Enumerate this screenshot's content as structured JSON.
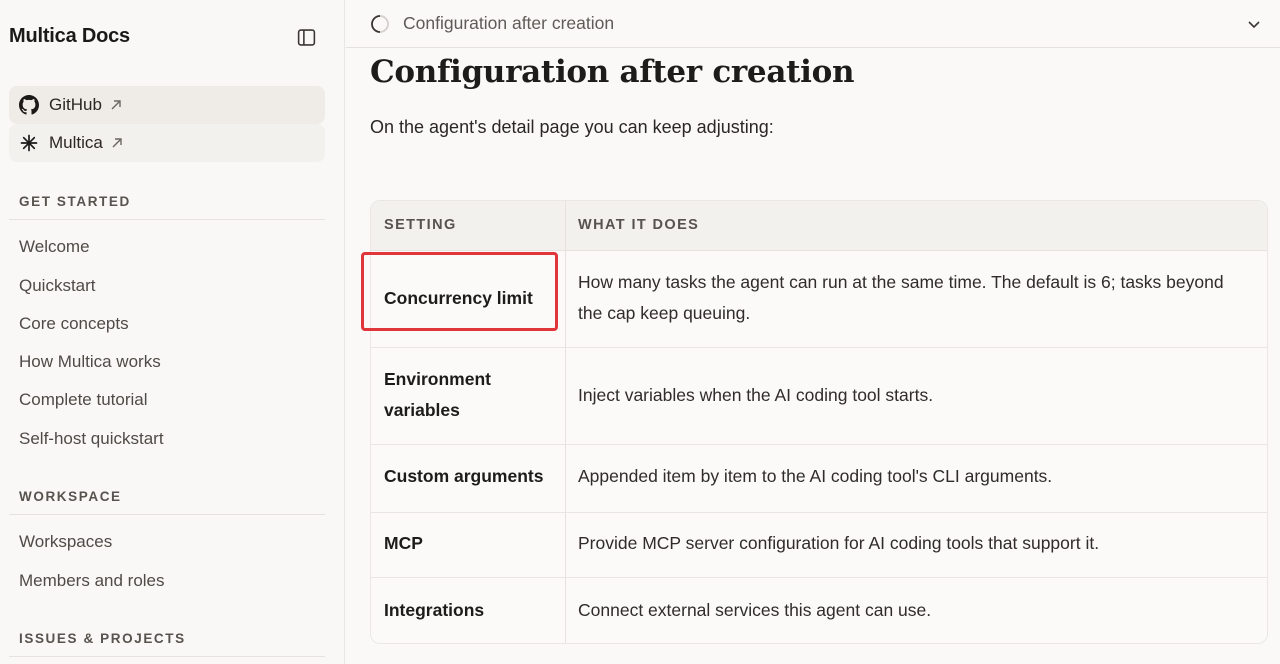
{
  "sidebar": {
    "brand": "Multica Docs",
    "external_links": [
      {
        "label": "GitHub",
        "icon": "github-icon"
      },
      {
        "label": "Multica",
        "icon": "asterisk-icon"
      }
    ],
    "sections": [
      {
        "heading": "GET STARTED",
        "items": [
          "Welcome",
          "Quickstart",
          "Core concepts",
          "How Multica works",
          "Complete tutorial",
          "Self-host quickstart"
        ]
      },
      {
        "heading": "WORKSPACE",
        "items": [
          "Workspaces",
          "Members and roles"
        ]
      },
      {
        "heading": "ISSUES & PROJECTS",
        "items": []
      }
    ]
  },
  "topbar": {
    "toc_title": "Configuration after creation"
  },
  "main": {
    "title": "Configuration after creation",
    "intro": "On the agent's detail page you can keep adjusting:",
    "table": {
      "headers": [
        "SETTING",
        "WHAT IT DOES"
      ],
      "rows": [
        {
          "setting": "Concurrency limit",
          "description": "How many tasks the agent can run at the same time. The default is 6; tasks beyond the cap keep queuing.",
          "highlighted": true
        },
        {
          "setting": "Environment variables",
          "description": "Inject variables when the AI coding tool starts."
        },
        {
          "setting": "Custom arguments",
          "description": "Appended item by item to the AI coding tool's CLI arguments."
        },
        {
          "setting": "MCP",
          "description": "Provide MCP server configuration for AI coding tools that support it."
        },
        {
          "setting": "Integrations",
          "description": "Connect external services this agent can use."
        }
      ]
    }
  },
  "colors": {
    "highlight": "#e0353b",
    "background": "#faf9f7"
  }
}
